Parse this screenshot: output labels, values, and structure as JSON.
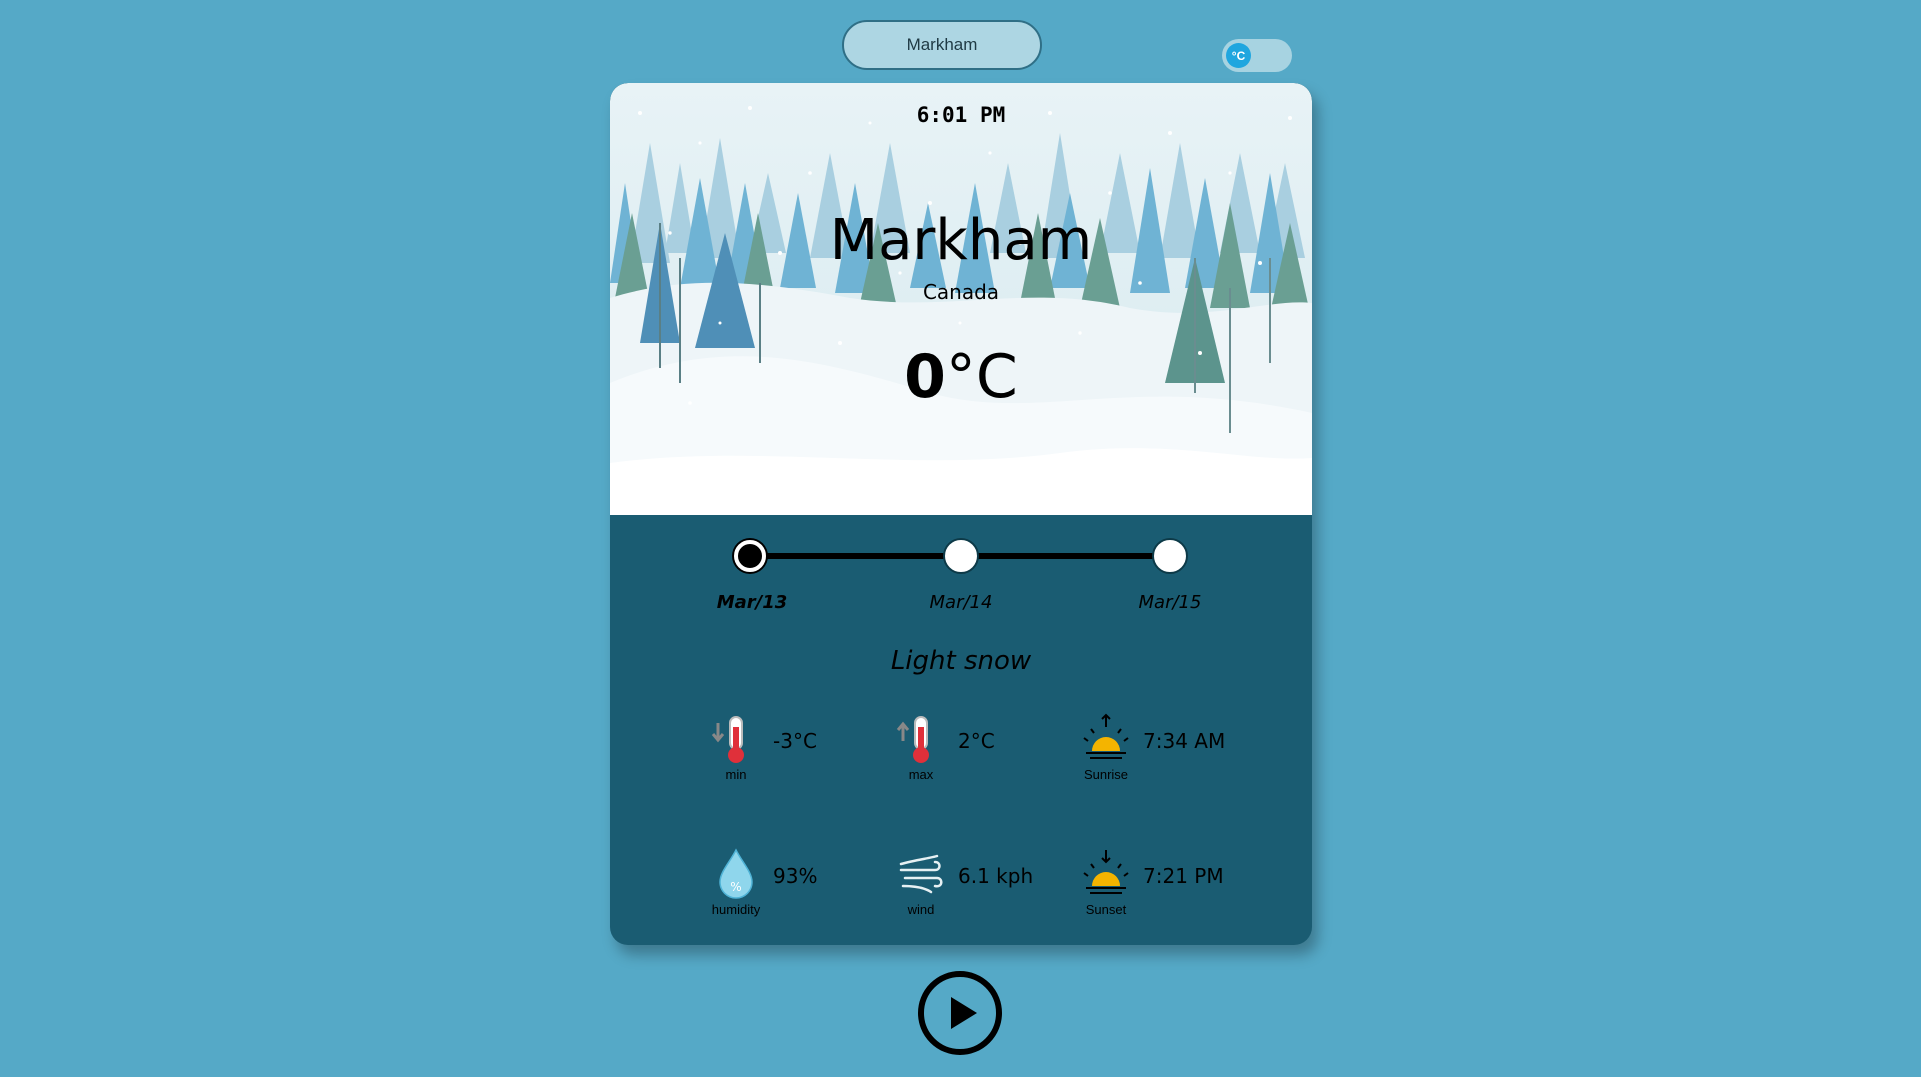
{
  "search": {
    "value": "Markham"
  },
  "unit_toggle": {
    "label": "°C"
  },
  "weather": {
    "time": "6:01 PM",
    "city": "Markham",
    "country": "Canada",
    "temp_value": "0",
    "temp_unit": "°C",
    "description": "Light snow"
  },
  "forecast_days": [
    {
      "label": "Mar/13",
      "active": true
    },
    {
      "label": "Mar/14",
      "active": false
    },
    {
      "label": "Mar/15",
      "active": false
    }
  ],
  "stats": {
    "min": {
      "caption": "min",
      "value": "-3°C",
      "icon": "thermometer-down-icon"
    },
    "max": {
      "caption": "max",
      "value": "2°C",
      "icon": "thermometer-up-icon"
    },
    "sunrise": {
      "caption": "Sunrise",
      "value": "7:34 AM",
      "icon": "sunrise-icon"
    },
    "humidity": {
      "caption": "humidity",
      "value": "93%",
      "icon": "humidity-drop-icon"
    },
    "wind": {
      "caption": "wind",
      "value": "6.1 kph",
      "icon": "wind-icon"
    },
    "sunset": {
      "caption": "Sunset",
      "value": "7:21 PM",
      "icon": "sunset-icon"
    }
  },
  "colors": {
    "background": "#55a9c7",
    "card": "#1a5c72",
    "toggle_knob": "#1fa6df"
  },
  "play_button": {
    "icon": "play-icon"
  }
}
